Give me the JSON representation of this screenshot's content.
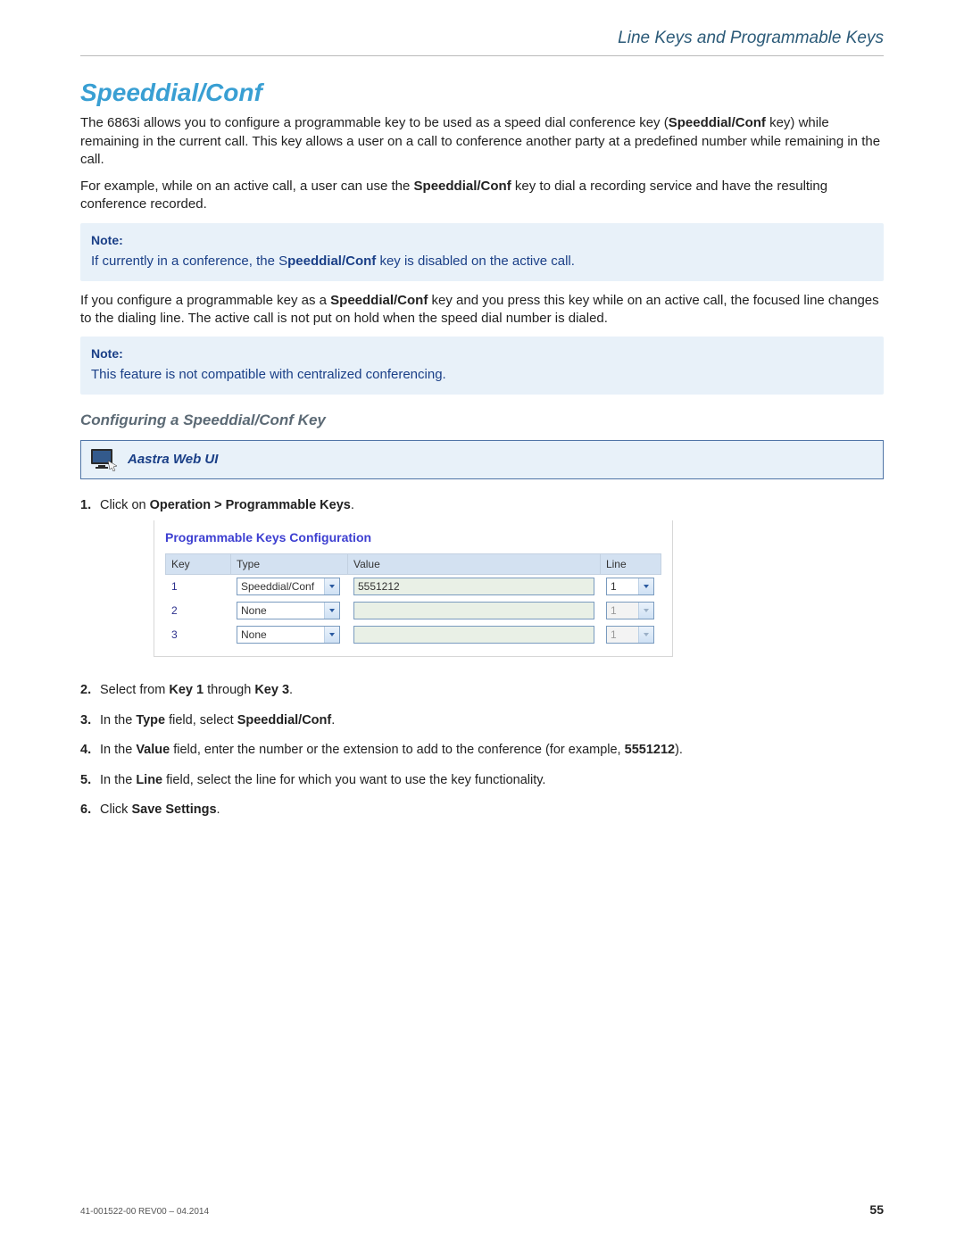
{
  "running_head": "Line Keys and Programmable Keys",
  "section_title": "Speeddial/Conf",
  "para1_pre": "The 6863i allows you to configure a programmable key to be used as a speed dial conference key (",
  "para1_bold": "Speeddial/Conf",
  "para1_post": " key) while remaining in the current call. This key allows a user on a call to conference another party at a predefined number while remaining in the call.",
  "para2_pre": "For example, while on an active call, a user can use the ",
  "para2_bold": "Speeddial/Conf",
  "para2_post": " key to dial a recording service and have the resulting conference recorded.",
  "note_label": "Note:",
  "note1_pre": "If currently in a conference, the S",
  "note1_bold": "peeddial/Conf",
  "note1_post": " key is disabled on the active call.",
  "para3_pre": "If you configure a programmable key as a ",
  "para3_bold": "Speeddial/Conf",
  "para3_post": " key and you press this key while on an active call, the focused line changes to the dialing line. The active call is not put on hold when the speed dial number is dialed.",
  "note2": "This feature is not compatible with centralized conferencing.",
  "subsection": "Configuring a Speeddial/Conf Key",
  "webui_label": "Aastra Web UI",
  "steps": {
    "s1_pre": "Click on ",
    "s1_bold": "Operation > Programmable Keys",
    "s1_post": ".",
    "s2_pre": "Select from ",
    "s2_b1": "Key 1",
    "s2_mid": " through ",
    "s2_b2": "Key 3",
    "s2_post": ".",
    "s3_pre": "In the ",
    "s3_b1": "Type",
    "s3_mid": " field, select ",
    "s3_b2": "Speeddial/Conf",
    "s3_post": ".",
    "s4_pre": "In the ",
    "s4_b1": "Value",
    "s4_mid": " field, enter the number or the extension to add to the conference (for example, ",
    "s4_b2": "5551212",
    "s4_post": ").",
    "s5_pre": "In the ",
    "s5_b1": "Line",
    "s5_post": " field, select the line for which you want to use the key functionality.",
    "s6_pre": "Click ",
    "s6_b1": "Save Settings",
    "s6_post": "."
  },
  "config": {
    "title": "Programmable Keys Configuration",
    "headers": {
      "key": "Key",
      "type": "Type",
      "value": "Value",
      "line": "Line"
    },
    "rows": [
      {
        "key": "1",
        "type": "Speeddial/Conf",
        "value": "5551212",
        "line": "1",
        "disabled": false
      },
      {
        "key": "2",
        "type": "None",
        "value": "",
        "line": "1",
        "disabled": true
      },
      {
        "key": "3",
        "type": "None",
        "value": "",
        "line": "1",
        "disabled": true
      }
    ]
  },
  "footer_doc": "41-001522-00 REV00 – 04.2014",
  "page_number": "55"
}
